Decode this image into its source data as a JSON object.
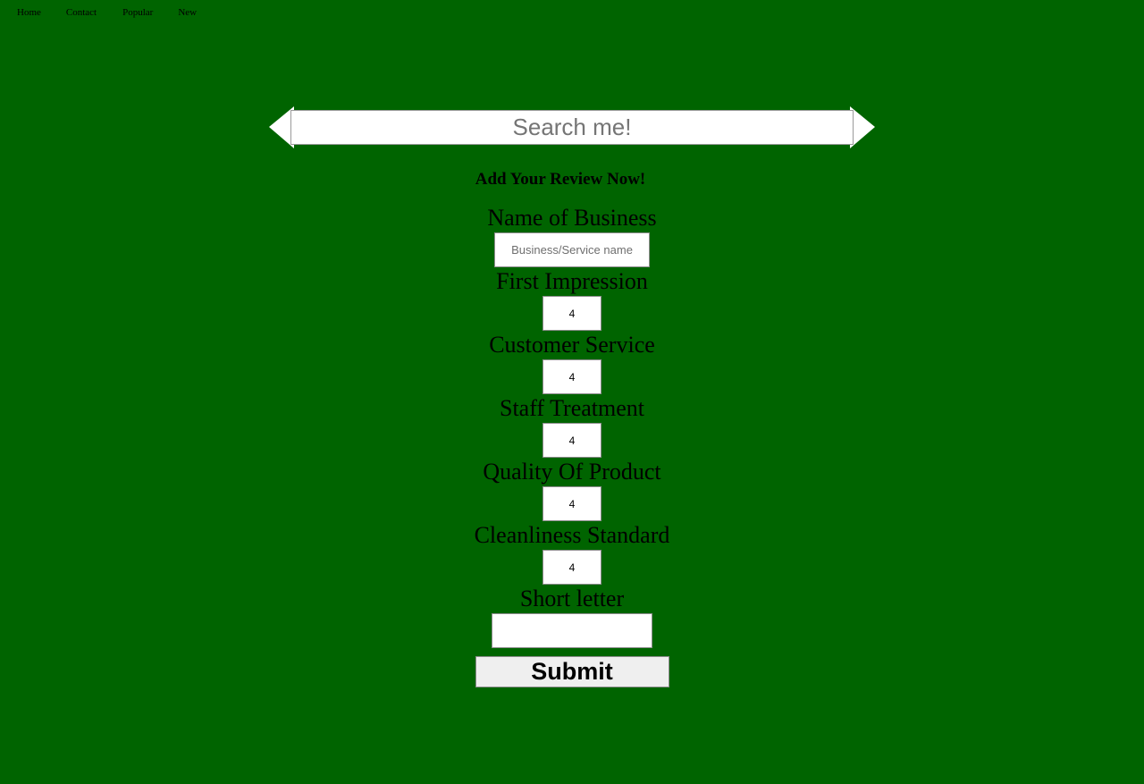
{
  "nav": {
    "items": [
      {
        "label": "Home"
      },
      {
        "label": "Contact"
      },
      {
        "label": "Popular"
      },
      {
        "label": "New"
      }
    ]
  },
  "search": {
    "placeholder": "Search me!",
    "value": ""
  },
  "form": {
    "title": "Add Your Review Now!",
    "business": {
      "label": "Name of Business",
      "placeholder": "Business/Service name",
      "value": ""
    },
    "first_impression": {
      "label": "First Impression",
      "value": "4"
    },
    "customer_service": {
      "label": "Customer Service",
      "value": "4"
    },
    "staff_treatment": {
      "label": "Staff Treatment",
      "value": "4"
    },
    "quality_of_product": {
      "label": "Quality Of Product",
      "value": "4"
    },
    "cleanliness_standard": {
      "label": "Cleanliness Standard",
      "value": "4"
    },
    "short_letter": {
      "label": "Short letter",
      "value": ""
    },
    "submit_label": "Submit"
  },
  "colors": {
    "background": "#006400",
    "input_background": "#ffffff",
    "button_background": "#efefef"
  }
}
